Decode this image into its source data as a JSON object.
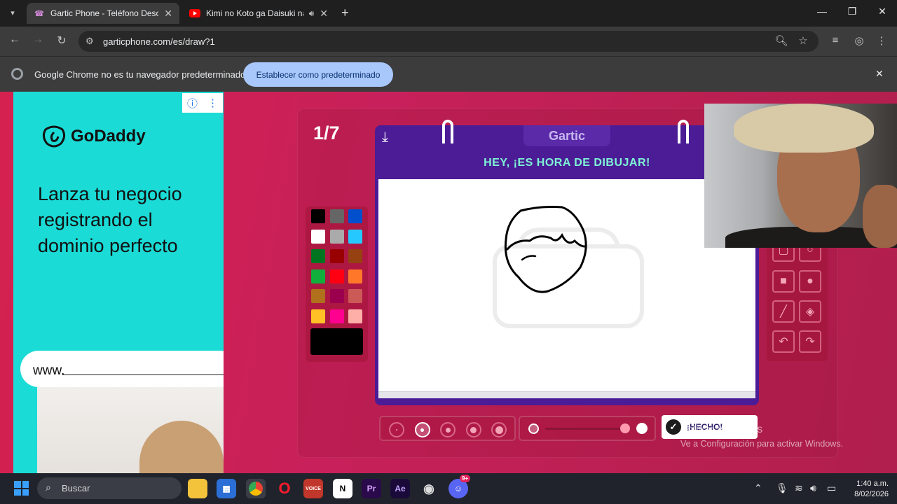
{
  "tabs": [
    {
      "title": "Gartic Phone - Teléfono Descon",
      "favicon": "phone-icon",
      "active": true
    },
    {
      "title": "Kimi no Koto ga Daisuki na",
      "favicon": "youtube-icon",
      "active": false
    }
  ],
  "toolbar": {
    "url": "garticphone.com/es/draw?1"
  },
  "infobar": {
    "message": "Google Chrome no es tu navegador predeterminado",
    "button_label": "Establecer como predeterminado"
  },
  "ad": {
    "brand": "GoDaddy",
    "headline": "Lanza tu negocio registrando el dominio perfecto",
    "url_prefix": "www."
  },
  "game": {
    "round": "1/7",
    "brand": "Gartic",
    "header": "HEY, ¡ES HORA DE DIBUJAR!",
    "done_label": "¡HECHO!",
    "palette": [
      "#000000",
      "#666666",
      "#0050cd",
      "#ffffff",
      "#aaaaaa",
      "#26c9ff",
      "#017420",
      "#990000",
      "#964112",
      "#11b03c",
      "#ff0013",
      "#ff7829",
      "#b0701c",
      "#99004e",
      "#cb5a57",
      "#ffc126",
      "#ff008f",
      "#feafa8"
    ],
    "current_color": "#000000",
    "selected_size_index": 1,
    "opacity": 0.9
  },
  "watermark": {
    "line1": "Activar Windows",
    "line2": "Ve a Configuración para activar Windows."
  },
  "taskbar": {
    "search_placeholder": "Buscar",
    "time": "1:40 a.m.",
    "date": "8/02/2026",
    "discord_badge": "9+"
  }
}
